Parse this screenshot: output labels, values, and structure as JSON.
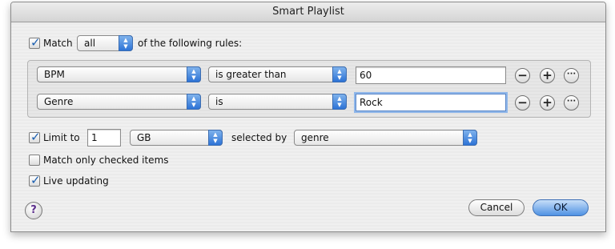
{
  "window": {
    "title": "Smart Playlist"
  },
  "match": {
    "checked": true,
    "label": "Match",
    "mode": "all",
    "suffix": "of the following rules:"
  },
  "rules": [
    {
      "field": "BPM",
      "operator": "is greater than",
      "value": "60"
    },
    {
      "field": "Genre",
      "operator": "is",
      "value": "Rock"
    }
  ],
  "limit": {
    "checked": true,
    "label": "Limit to",
    "value": "1",
    "unit": "GB",
    "selected_by_label": "selected by",
    "selected_by": "genre"
  },
  "options": {
    "match_checked": {
      "checked": false,
      "label": "Match only checked items"
    },
    "live_updating": {
      "checked": true,
      "label": "Live updating"
    }
  },
  "buttons": {
    "help": "?",
    "cancel": "Cancel",
    "ok": "OK",
    "remove": "−",
    "add": "+",
    "more": "···"
  },
  "colors": {
    "accent": "#2d73d6",
    "check": "#1b5fb0"
  }
}
